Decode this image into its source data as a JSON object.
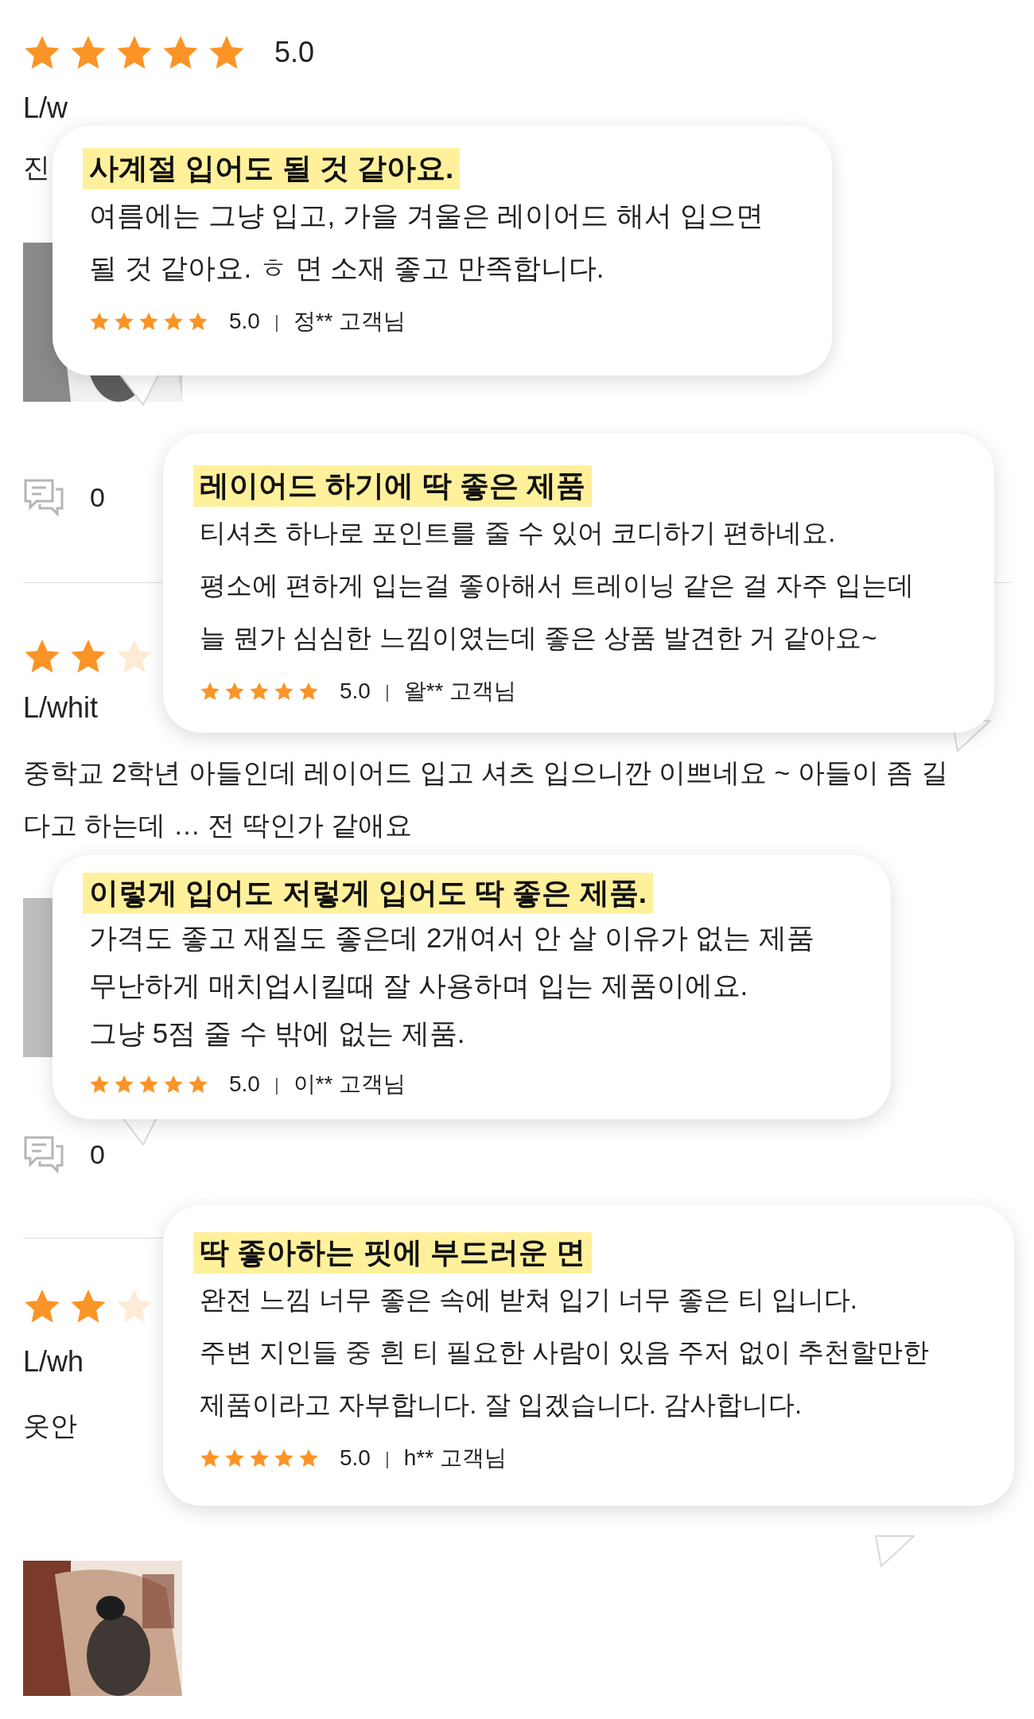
{
  "reviews": [
    {
      "stars": 5,
      "rating": "5.0",
      "option": "L/w",
      "text_lines": [
        "진"
      ],
      "photo": {
        "kind": "picture"
      },
      "comment_count": "0"
    },
    {
      "stars": 2,
      "option": "L/whit",
      "text_lines": [
        "중학교 2학년 아들인데 레이어드 입고 셔츠 입으니깐 이쁘네요 ~ 아들이 좀 길",
        "다고 하는데 … 전 딱인가 같애요"
      ],
      "photo": {
        "kind": "picture"
      },
      "comment_count": "0"
    },
    {
      "stars": 2,
      "option": "L/wh",
      "text_lines": [
        "옷안"
      ],
      "photo": {
        "kind": "picture"
      }
    }
  ],
  "bubbles": [
    {
      "title": "사계절 입어도 될 것 같아요.",
      "lines": [
        "여름에는 그냥 입고, 가을 겨울은 레이어드 해서 입으면",
        "될 것 같아요. ㅎ 면 소재 좋고 만족합니다."
      ],
      "stars": 5,
      "rating": "5.0",
      "separator": "|",
      "author": "정** 고객님"
    },
    {
      "title": "레이어드 하기에 딱 좋은 제품",
      "lines": [
        "티셔츠 하나로 포인트를 줄 수 있어 코디하기 편하네요.",
        "평소에 편하게 입는걸 좋아해서 트레이닝 같은 걸 자주 입는데",
        "늘 뭔가 심심한 느낌이였는데 좋은 상품 발견한 거 같아요~"
      ],
      "stars": 5,
      "rating": "5.0",
      "separator": "|",
      "author": "왈** 고객님"
    },
    {
      "title": "이렇게 입어도 저렇게 입어도 딱 좋은 제품.",
      "lines": [
        "가격도 좋고 재질도 좋은데 2개여서 안 살 이유가 없는 제품",
        "무난하게 매치업시킬때 잘 사용하며 입는 제품이에요.",
        "그냥 5점 줄 수 밖에 없는 제품."
      ],
      "stars": 5,
      "rating": "5.0",
      "separator": "|",
      "author": "이** 고객님"
    },
    {
      "title": "딱 좋아하는 핏에 부드러운 면",
      "lines": [
        "완전 느낌 너무 좋은 속에 받쳐 입기 너무 좋은 티 입니다.",
        "주변 지인들 중 흰 티 필요한 사람이 있음 주저 없이 추천할만한",
        "제품이라고 자부합니다. 잘 입겠습니다. 감사합니다."
      ],
      "stars": 5,
      "rating": "5.0",
      "separator": "|",
      "author": "h** 고객님"
    }
  ]
}
